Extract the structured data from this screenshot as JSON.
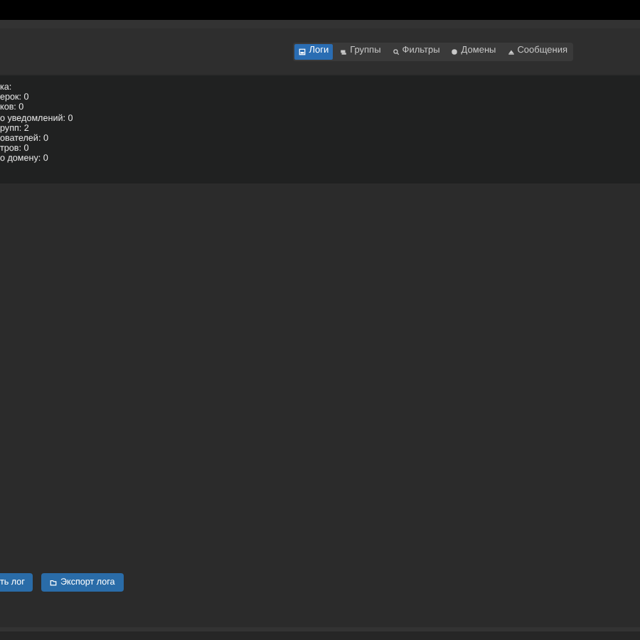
{
  "tabs": [
    {
      "label": "Логи",
      "selected": true
    },
    {
      "label": "Группы",
      "selected": false
    },
    {
      "label": "Фильтры",
      "selected": false
    },
    {
      "label": "Домены",
      "selected": false
    },
    {
      "label": "Сообщения",
      "selected": false
    }
  ],
  "stats": [
    "ка:",
    "ерок: 0",
    "ков: 0",
    "о уведомлений: 0",
    "рупп: 2",
    "ователей: 0",
    "тров: 0",
    "о домену: 0"
  ],
  "buttons": [
    "ть лог",
    "Экспорт лога"
  ]
}
